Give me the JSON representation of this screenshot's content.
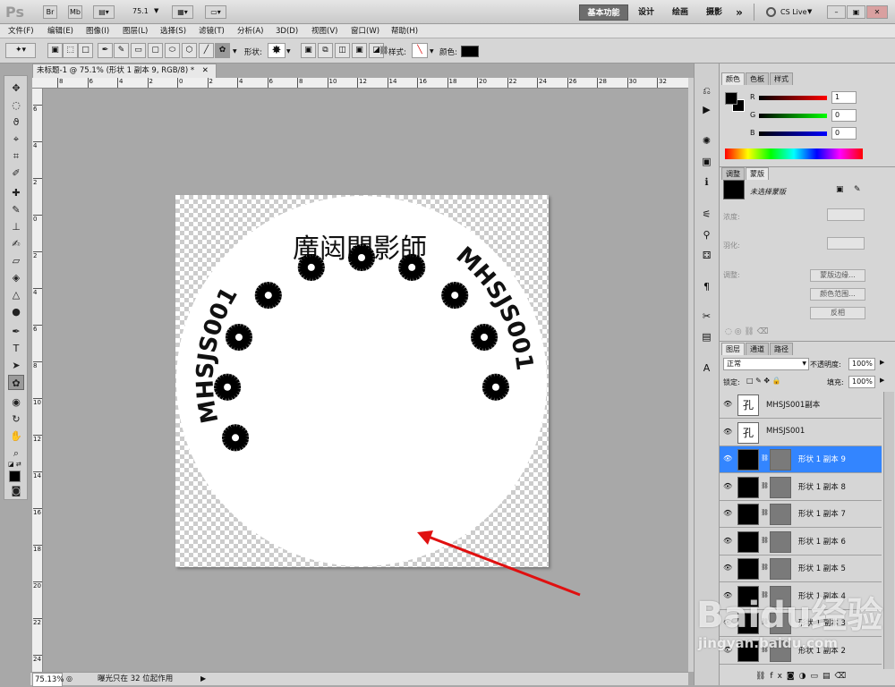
{
  "titlebar": {
    "logo": "Ps",
    "br_label": "Br",
    "mb_label": "Mb",
    "zoom": "75.1",
    "workspaces": [
      "基本功能",
      "设计",
      "绘画",
      "摄影"
    ],
    "more": "»",
    "cs_live": "CS Live"
  },
  "menu": [
    "文件(F)",
    "编辑(E)",
    "图像(I)",
    "图层(L)",
    "选择(S)",
    "滤镜(T)",
    "分析(A)",
    "3D(D)",
    "视图(V)",
    "窗口(W)",
    "帮助(H)"
  ],
  "options": {
    "shape_label": "形状:",
    "style_label": "样式:",
    "color_label": "颜色:",
    "color": "#000000"
  },
  "document": {
    "tab_title": "未标题-1 @ 75.1% (形状 1 副本 9, RGB/8) *",
    "ruler_top": [
      "8",
      "6",
      "4",
      "2",
      "0",
      "2",
      "4",
      "6",
      "8",
      "10",
      "12",
      "14",
      "16",
      "18",
      "20",
      "22",
      "24",
      "26",
      "28",
      "30",
      "32"
    ],
    "ruler_left": [
      "6",
      "4",
      "2",
      "0",
      "2",
      "4",
      "6",
      "8",
      "10",
      "12",
      "14",
      "16",
      "18",
      "20",
      "22",
      "24"
    ],
    "circle_text_left": "MHSJS001",
    "circle_text_right": "MHSJS001",
    "center_text": "廣闼聞影師",
    "flower_count": 10
  },
  "status": {
    "zoom": "75.13%",
    "message": "曝光只在 32 位起作用"
  },
  "color_panel": {
    "tabs": [
      "颜色",
      "色板",
      "样式"
    ],
    "r_label": "R",
    "g_label": "G",
    "b_label": "B",
    "r": "1",
    "g": "0",
    "b": "0"
  },
  "adjust_panel": {
    "tabs": [
      "调整",
      "蒙版"
    ],
    "mask_label": "未选择蒙版",
    "density": "浓度:",
    "feather": "羽化:",
    "adjust": "调整:",
    "btn_edge": "蒙版边缘...",
    "btn_range": "颜色范围...",
    "btn_invert": "反相"
  },
  "layers_panel": {
    "tabs": [
      "图层",
      "通道",
      "路径"
    ],
    "blend_mode": "正常",
    "opacity_label": "不透明度:",
    "opacity": "100%",
    "lock_label": "锁定:",
    "fill_label": "填充:",
    "fill": "100%",
    "layers": [
      {
        "name": "MHSJS001副本",
        "type": "text",
        "selected": false
      },
      {
        "name": "MHSJS001",
        "type": "text",
        "selected": false
      },
      {
        "name": "形状 1 副本 9",
        "type": "shape",
        "selected": true
      },
      {
        "name": "形状 1 副本 8",
        "type": "shape",
        "selected": false
      },
      {
        "name": "形状 1 副本 7",
        "type": "shape",
        "selected": false
      },
      {
        "name": "形状 1 副本 6",
        "type": "shape",
        "selected": false
      },
      {
        "name": "形状 1 副本 5",
        "type": "shape",
        "selected": false
      },
      {
        "name": "形状 1 副本 4",
        "type": "shape",
        "selected": false
      },
      {
        "name": "形状 1 副本 3",
        "type": "shape",
        "selected": false
      },
      {
        "name": "形状 1 副本 2",
        "type": "shape",
        "selected": false
      }
    ]
  },
  "watermark": {
    "brand": "Baidu经验",
    "url": "jingyan.baidu.com"
  },
  "colors": {
    "selected_layer": "#3385ff",
    "arrow": "#e01010"
  }
}
